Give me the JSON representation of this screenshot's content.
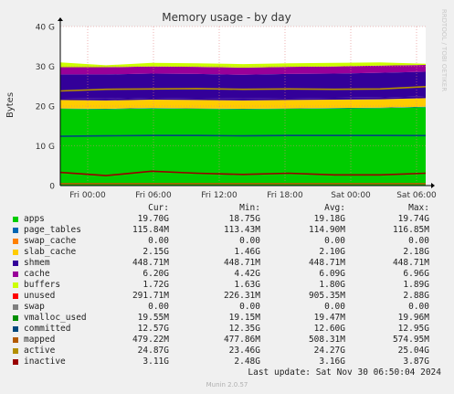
{
  "chart_data": {
    "type": "area",
    "title": "Memory usage - by day",
    "ylabel": "Bytes",
    "watermark": "RRDTOOL / TOBI OETIKER",
    "ylim": [
      0,
      40
    ],
    "y_unit": "G",
    "yticks": [
      "0",
      "10 G",
      "20 G",
      "30 G",
      "40 G"
    ],
    "xticks": [
      "Fri 00:00",
      "Fri 06:00",
      "Fri 12:00",
      "Fri 18:00",
      "Sat 00:00",
      "Sat 06:00"
    ],
    "grid": true,
    "stacked_series": [
      {
        "name": "apps",
        "color": "#00cc00",
        "values_gb": [
          19.3,
          19.2,
          19.4,
          19.3,
          19.2,
          19.3,
          19.4,
          19.5,
          19.7
        ]
      },
      {
        "name": "page_tables",
        "color": "#0066b3",
        "values_gb": [
          0.11,
          0.11,
          0.11,
          0.11,
          0.11,
          0.11,
          0.11,
          0.11,
          0.12
        ]
      },
      {
        "name": "swap_cache",
        "color": "#ff8000",
        "values_gb": [
          0,
          0,
          0,
          0,
          0,
          0,
          0,
          0,
          0
        ]
      },
      {
        "name": "slab_cache",
        "color": "#ffcc00",
        "values_gb": [
          2.1,
          2.1,
          2.1,
          2.1,
          2.1,
          2.1,
          2.1,
          2.1,
          2.15
        ]
      },
      {
        "name": "shmem",
        "color": "#330099",
        "values_gb": [
          0.45,
          0.45,
          0.45,
          0.45,
          0.45,
          0.45,
          0.45,
          0.45,
          0.45
        ]
      },
      {
        "name": "cache",
        "color": "#330099",
        "values_gb": [
          6.0,
          6.1,
          6.1,
          6.1,
          6.0,
          6.1,
          6.1,
          6.2,
          6.2
        ]
      },
      {
        "name": "buffers",
        "color": "#990099",
        "values_gb": [
          1.8,
          1.8,
          1.8,
          1.8,
          1.8,
          1.8,
          1.8,
          1.8,
          1.72
        ]
      },
      {
        "name": "unused",
        "color": "#ccff00",
        "values_gb": [
          1.2,
          0.5,
          0.9,
          0.9,
          0.9,
          0.9,
          0.9,
          0.8,
          0.3
        ]
      }
    ],
    "line_series": [
      {
        "name": "committed",
        "color": "#00487d",
        "values_gb": [
          12.4,
          12.5,
          12.6,
          12.6,
          12.5,
          12.6,
          12.6,
          12.6,
          12.57
        ]
      },
      {
        "name": "mapped",
        "color": "#b35a00",
        "values_gb": [
          0.48,
          0.48,
          0.48,
          0.48,
          0.48,
          0.48,
          0.48,
          0.48,
          0.48
        ]
      },
      {
        "name": "active",
        "color": "#b38f00",
        "values_gb": [
          23.8,
          24.2,
          24.3,
          24.4,
          24.2,
          24.3,
          24.2,
          24.3,
          24.87
        ]
      },
      {
        "name": "inactive",
        "color": "#990000",
        "values_gb": [
          3.3,
          2.5,
          3.6,
          3.1,
          2.8,
          3.1,
          2.7,
          2.7,
          3.11
        ]
      }
    ]
  },
  "legend": {
    "headers": [
      "Cur:",
      "Min:",
      "Avg:",
      "Max:"
    ],
    "rows": [
      {
        "name": "apps",
        "color": "#00cc00",
        "cur": "19.70G",
        "min": "18.75G",
        "avg": "19.18G",
        "max": "19.74G"
      },
      {
        "name": "page_tables",
        "color": "#0066b3",
        "cur": "115.84M",
        "min": "113.43M",
        "avg": "114.90M",
        "max": "116.85M"
      },
      {
        "name": "swap_cache",
        "color": "#ff8000",
        "cur": "0.00",
        "min": "0.00",
        "avg": "0.00",
        "max": "0.00"
      },
      {
        "name": "slab_cache",
        "color": "#ffcc00",
        "cur": "2.15G",
        "min": "1.46G",
        "avg": "2.10G",
        "max": "2.18G"
      },
      {
        "name": "shmem",
        "color": "#330099",
        "cur": "448.71M",
        "min": "448.71M",
        "avg": "448.71M",
        "max": "448.71M"
      },
      {
        "name": "cache",
        "color": "#990099",
        "cur": "6.20G",
        "min": "4.42G",
        "avg": "6.09G",
        "max": "6.96G"
      },
      {
        "name": "buffers",
        "color": "#ccff00",
        "cur": "1.72G",
        "min": "1.63G",
        "avg": "1.80G",
        "max": "1.89G"
      },
      {
        "name": "unused",
        "color": "#ff0000",
        "cur": "291.71M",
        "min": "226.31M",
        "avg": "905.35M",
        "max": "2.88G"
      },
      {
        "name": "swap",
        "color": "#808080",
        "cur": "0.00",
        "min": "0.00",
        "avg": "0.00",
        "max": "0.00"
      },
      {
        "name": "vmalloc_used",
        "color": "#008f00",
        "cur": "19.55M",
        "min": "19.15M",
        "avg": "19.47M",
        "max": "19.96M"
      },
      {
        "name": "committed",
        "color": "#00487d",
        "cur": "12.57G",
        "min": "12.35G",
        "avg": "12.60G",
        "max": "12.95G"
      },
      {
        "name": "mapped",
        "color": "#b35a00",
        "cur": "479.22M",
        "min": "477.86M",
        "avg": "508.31M",
        "max": "574.95M"
      },
      {
        "name": "active",
        "color": "#b38f00",
        "cur": "24.87G",
        "min": "23.46G",
        "avg": "24.27G",
        "max": "25.04G"
      },
      {
        "name": "inactive",
        "color": "#990000",
        "cur": "3.11G",
        "min": "2.48G",
        "avg": "3.16G",
        "max": "3.87G"
      }
    ]
  },
  "footer": {
    "last_update": "Last update: Sat Nov 30 06:50:04 2024",
    "munin": "Munin 2.0.57"
  }
}
